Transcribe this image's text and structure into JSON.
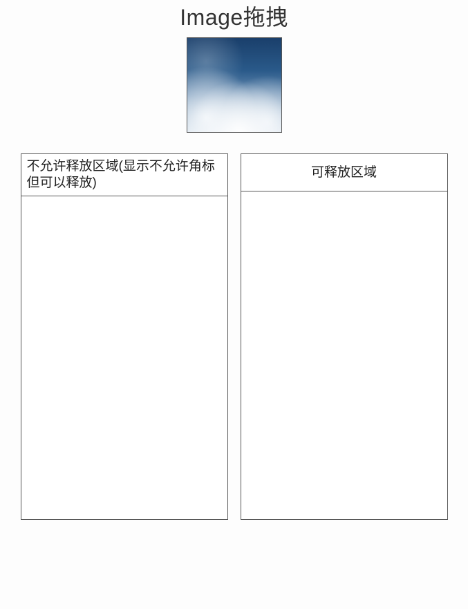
{
  "page": {
    "title": "Image拖拽"
  },
  "image": {
    "alt": "sky-clouds-image"
  },
  "zones": {
    "left": {
      "header": "不允许释放区域(显示不允许角标但可以释放)"
    },
    "right": {
      "header": "可释放区域"
    }
  }
}
